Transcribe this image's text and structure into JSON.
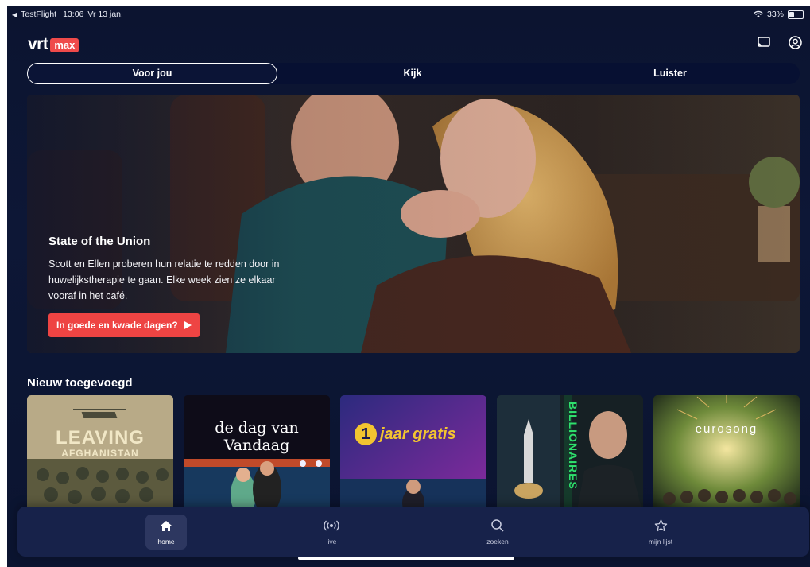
{
  "status": {
    "app": "TestFlight",
    "time": "13:06",
    "date": "Vr 13 jan.",
    "battery": "33%",
    "back_arrow": "◀"
  },
  "logo": {
    "vrt": "vrt",
    "max": "max",
    "max_color": "#ef4a4a"
  },
  "header_icons": [
    "cast-icon",
    "account-icon"
  ],
  "tabs": [
    {
      "label": "Voor jou",
      "active": true
    },
    {
      "label": "Kijk",
      "active": false
    },
    {
      "label": "Luister",
      "active": false
    }
  ],
  "hero": {
    "title": "State of the Union",
    "description": "Scott en Ellen proberen hun relatie te redden door in huwelijkstherapie te gaan. Elke week zien ze elkaar vooraf in het café.",
    "cta": "In goede en kwade dagen?",
    "cta_icon": "play-icon"
  },
  "new_section": {
    "title": "Nieuw toegevoegd",
    "cards": [
      {
        "name": "leaving-afghanistan",
        "title": "LEAVING",
        "subtitle": "AFGHANISTAN"
      },
      {
        "name": "de-dag-van-vandaag",
        "title": "de dag van Vandaag"
      },
      {
        "name": "1-jaar-gratis",
        "number": "1",
        "title": "jaar gratis"
      },
      {
        "name": "billionaires",
        "title": "BILLIONAIRES"
      },
      {
        "name": "eurosong",
        "title": "eurosong"
      }
    ]
  },
  "bottom_nav": [
    {
      "label": "home",
      "icon": "home-icon",
      "active": true
    },
    {
      "label": "live",
      "icon": "live-icon",
      "active": false
    },
    {
      "label": "zoeken",
      "icon": "search-icon",
      "active": false
    },
    {
      "label": "mijn lijst",
      "icon": "star-icon",
      "active": false
    }
  ],
  "colors": {
    "accent": "#ee4443",
    "background": "#0c1430",
    "nav": "#17224a"
  }
}
